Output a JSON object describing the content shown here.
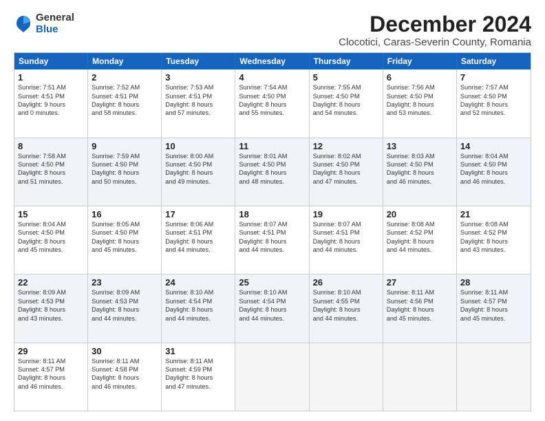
{
  "logo": {
    "general": "General",
    "blue": "Blue"
  },
  "title": "December 2024",
  "subtitle": "Clocotici, Caras-Severin County, Romania",
  "header_days": [
    "Sunday",
    "Monday",
    "Tuesday",
    "Wednesday",
    "Thursday",
    "Friday",
    "Saturday"
  ],
  "weeks": [
    [
      {
        "day": "1",
        "lines": [
          "Sunrise: 7:51 AM",
          "Sunset: 4:51 PM",
          "Daylight: 9 hours",
          "and 0 minutes."
        ]
      },
      {
        "day": "2",
        "lines": [
          "Sunrise: 7:52 AM",
          "Sunset: 4:51 PM",
          "Daylight: 8 hours",
          "and 58 minutes."
        ]
      },
      {
        "day": "3",
        "lines": [
          "Sunrise: 7:53 AM",
          "Sunset: 4:51 PM",
          "Daylight: 8 hours",
          "and 57 minutes."
        ]
      },
      {
        "day": "4",
        "lines": [
          "Sunrise: 7:54 AM",
          "Sunset: 4:50 PM",
          "Daylight: 8 hours",
          "and 55 minutes."
        ]
      },
      {
        "day": "5",
        "lines": [
          "Sunrise: 7:55 AM",
          "Sunset: 4:50 PM",
          "Daylight: 8 hours",
          "and 54 minutes."
        ]
      },
      {
        "day": "6",
        "lines": [
          "Sunrise: 7:56 AM",
          "Sunset: 4:50 PM",
          "Daylight: 8 hours",
          "and 53 minutes."
        ]
      },
      {
        "day": "7",
        "lines": [
          "Sunrise: 7:57 AM",
          "Sunset: 4:50 PM",
          "Daylight: 8 hours",
          "and 52 minutes."
        ]
      }
    ],
    [
      {
        "day": "8",
        "lines": [
          "Sunrise: 7:58 AM",
          "Sunset: 4:50 PM",
          "Daylight: 8 hours",
          "and 51 minutes."
        ]
      },
      {
        "day": "9",
        "lines": [
          "Sunrise: 7:59 AM",
          "Sunset: 4:50 PM",
          "Daylight: 8 hours",
          "and 50 minutes."
        ]
      },
      {
        "day": "10",
        "lines": [
          "Sunrise: 8:00 AM",
          "Sunset: 4:50 PM",
          "Daylight: 8 hours",
          "and 49 minutes."
        ]
      },
      {
        "day": "11",
        "lines": [
          "Sunrise: 8:01 AM",
          "Sunset: 4:50 PM",
          "Daylight: 8 hours",
          "and 48 minutes."
        ]
      },
      {
        "day": "12",
        "lines": [
          "Sunrise: 8:02 AM",
          "Sunset: 4:50 PM",
          "Daylight: 8 hours",
          "and 47 minutes."
        ]
      },
      {
        "day": "13",
        "lines": [
          "Sunrise: 8:03 AM",
          "Sunset: 4:50 PM",
          "Daylight: 8 hours",
          "and 46 minutes."
        ]
      },
      {
        "day": "14",
        "lines": [
          "Sunrise: 8:04 AM",
          "Sunset: 4:50 PM",
          "Daylight: 8 hours",
          "and 46 minutes."
        ]
      }
    ],
    [
      {
        "day": "15",
        "lines": [
          "Sunrise: 8:04 AM",
          "Sunset: 4:50 PM",
          "Daylight: 8 hours",
          "and 45 minutes."
        ]
      },
      {
        "day": "16",
        "lines": [
          "Sunrise: 8:05 AM",
          "Sunset: 4:50 PM",
          "Daylight: 8 hours",
          "and 45 minutes."
        ]
      },
      {
        "day": "17",
        "lines": [
          "Sunrise: 8:06 AM",
          "Sunset: 4:51 PM",
          "Daylight: 8 hours",
          "and 44 minutes."
        ]
      },
      {
        "day": "18",
        "lines": [
          "Sunrise: 8:07 AM",
          "Sunset: 4:51 PM",
          "Daylight: 8 hours",
          "and 44 minutes."
        ]
      },
      {
        "day": "19",
        "lines": [
          "Sunrise: 8:07 AM",
          "Sunset: 4:51 PM",
          "Daylight: 8 hours",
          "and 44 minutes."
        ]
      },
      {
        "day": "20",
        "lines": [
          "Sunrise: 8:08 AM",
          "Sunset: 4:52 PM",
          "Daylight: 8 hours",
          "and 44 minutes."
        ]
      },
      {
        "day": "21",
        "lines": [
          "Sunrise: 8:08 AM",
          "Sunset: 4:52 PM",
          "Daylight: 8 hours",
          "and 43 minutes."
        ]
      }
    ],
    [
      {
        "day": "22",
        "lines": [
          "Sunrise: 8:09 AM",
          "Sunset: 4:53 PM",
          "Daylight: 8 hours",
          "and 43 minutes."
        ]
      },
      {
        "day": "23",
        "lines": [
          "Sunrise: 8:09 AM",
          "Sunset: 4:53 PM",
          "Daylight: 8 hours",
          "and 44 minutes."
        ]
      },
      {
        "day": "24",
        "lines": [
          "Sunrise: 8:10 AM",
          "Sunset: 4:54 PM",
          "Daylight: 8 hours",
          "and 44 minutes."
        ]
      },
      {
        "day": "25",
        "lines": [
          "Sunrise: 8:10 AM",
          "Sunset: 4:54 PM",
          "Daylight: 8 hours",
          "and 44 minutes."
        ]
      },
      {
        "day": "26",
        "lines": [
          "Sunrise: 8:10 AM",
          "Sunset: 4:55 PM",
          "Daylight: 8 hours",
          "and 44 minutes."
        ]
      },
      {
        "day": "27",
        "lines": [
          "Sunrise: 8:11 AM",
          "Sunset: 4:56 PM",
          "Daylight: 8 hours",
          "and 45 minutes."
        ]
      },
      {
        "day": "28",
        "lines": [
          "Sunrise: 8:11 AM",
          "Sunset: 4:57 PM",
          "Daylight: 8 hours",
          "and 45 minutes."
        ]
      }
    ],
    [
      {
        "day": "29",
        "lines": [
          "Sunrise: 8:11 AM",
          "Sunset: 4:57 PM",
          "Daylight: 8 hours",
          "and 46 minutes."
        ]
      },
      {
        "day": "30",
        "lines": [
          "Sunrise: 8:11 AM",
          "Sunset: 4:58 PM",
          "Daylight: 8 hours",
          "and 46 minutes."
        ]
      },
      {
        "day": "31",
        "lines": [
          "Sunrise: 8:11 AM",
          "Sunset: 4:59 PM",
          "Daylight: 8 hours",
          "and 47 minutes."
        ]
      },
      {
        "day": "",
        "lines": []
      },
      {
        "day": "",
        "lines": []
      },
      {
        "day": "",
        "lines": []
      },
      {
        "day": "",
        "lines": []
      }
    ]
  ]
}
